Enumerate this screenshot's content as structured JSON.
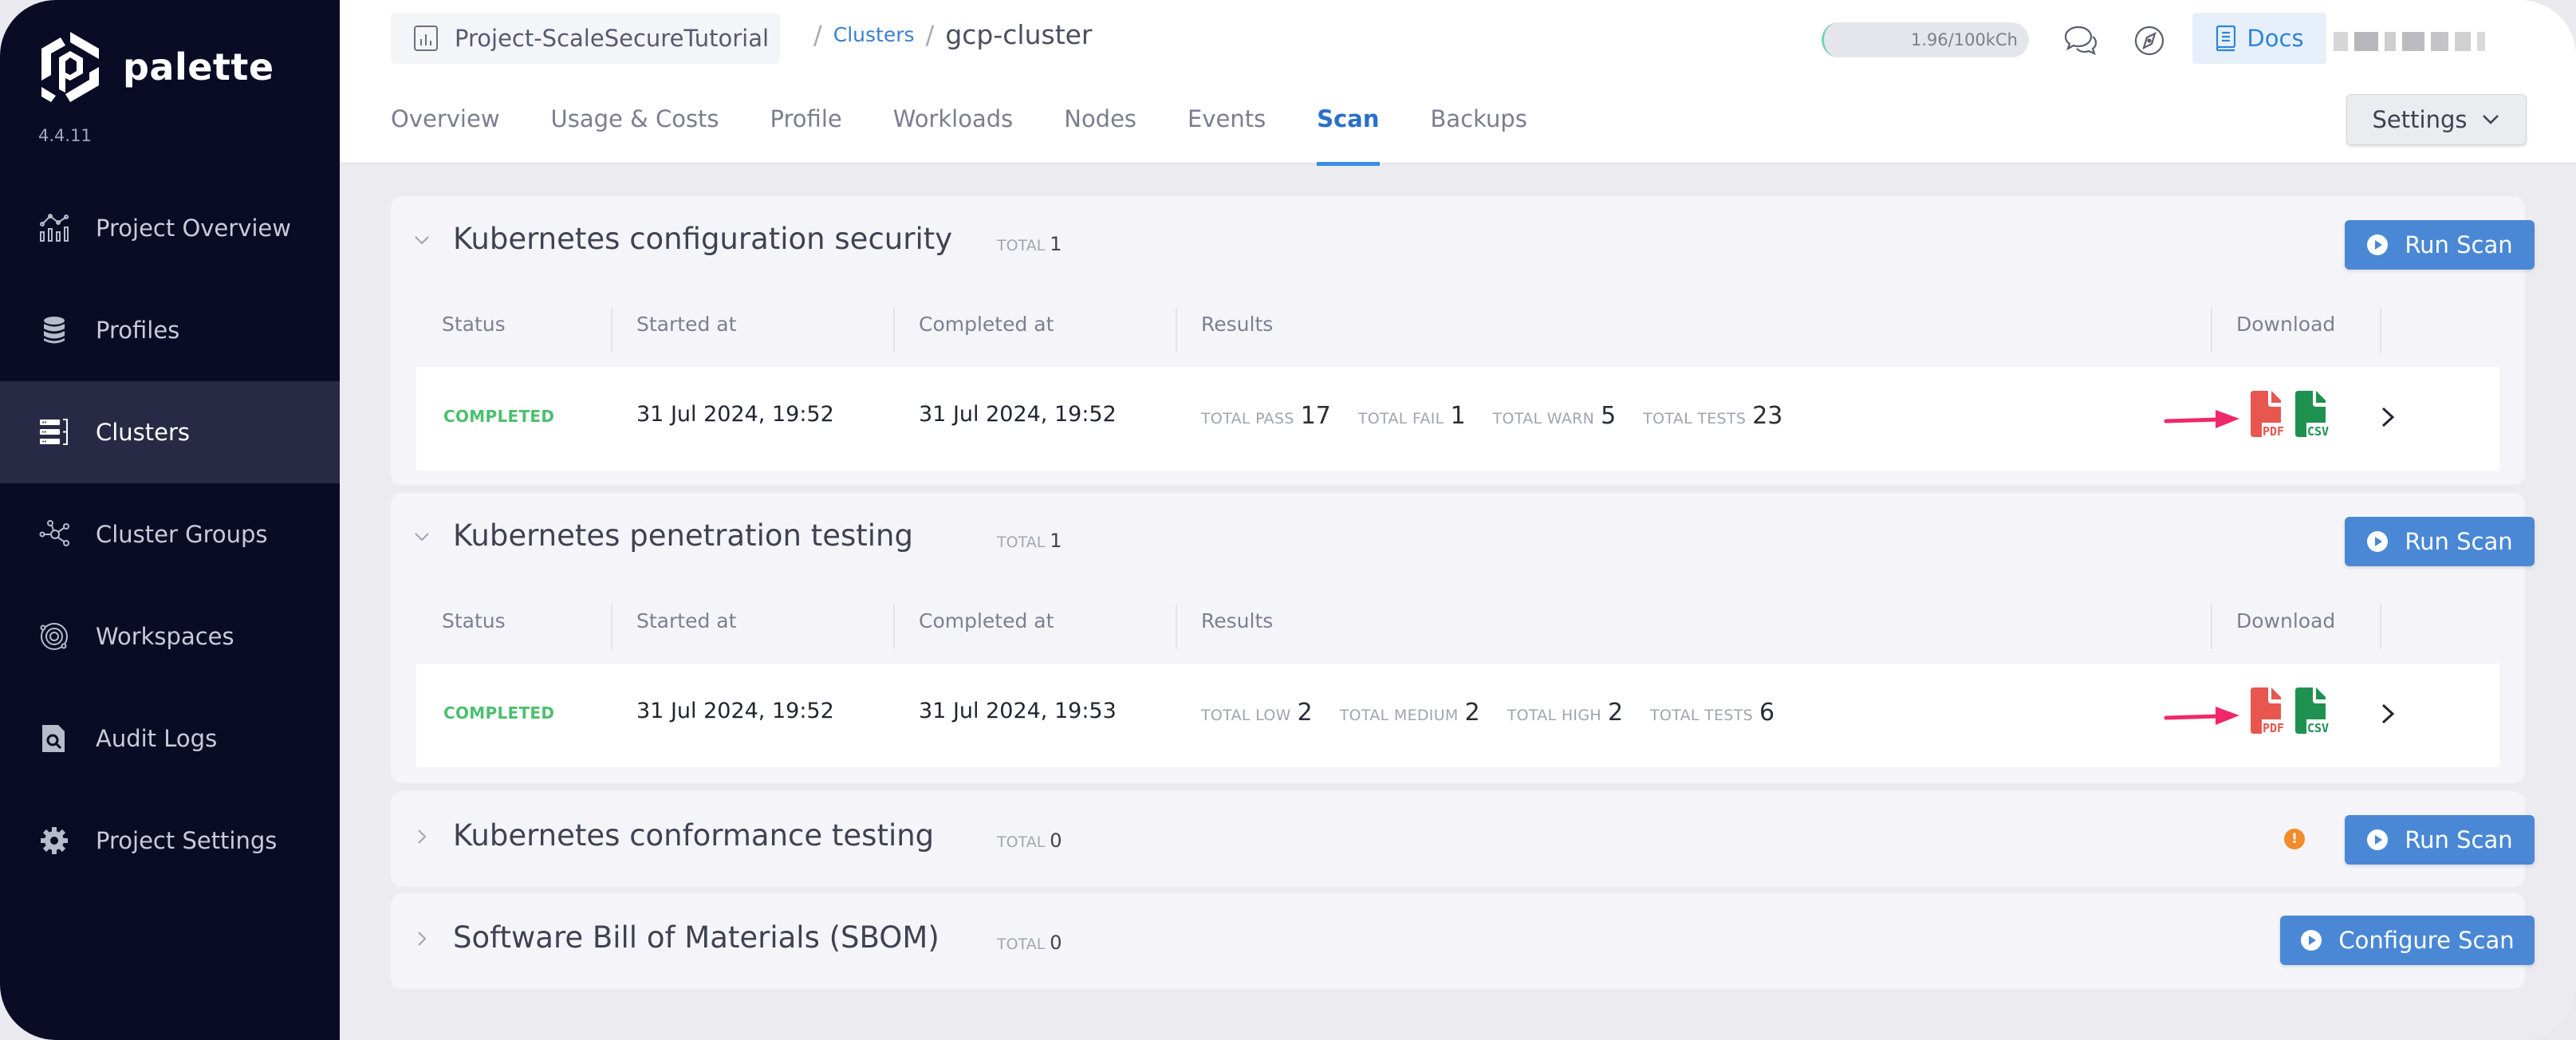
{
  "app": {
    "brand": "palette",
    "version": "4.4.11"
  },
  "sidebar": {
    "items": [
      {
        "label": "Project Overview",
        "icon": "chart-line-icon",
        "active": false
      },
      {
        "label": "Profiles",
        "icon": "database-stack-icon",
        "active": false
      },
      {
        "label": "Clusters",
        "icon": "server-rack-icon",
        "active": true
      },
      {
        "label": "Cluster Groups",
        "icon": "network-nodes-icon",
        "active": false
      },
      {
        "label": "Workspaces",
        "icon": "orbit-icon",
        "active": false
      },
      {
        "label": "Audit Logs",
        "icon": "document-search-icon",
        "active": false
      },
      {
        "label": "Project Settings",
        "icon": "gear-icon",
        "active": false
      }
    ]
  },
  "header": {
    "project": "Project-ScaleSecureTutorial",
    "breadcrumb": {
      "link": "Clusters",
      "current": "gcp-cluster"
    },
    "usage": "1.96/100kCh",
    "docs_label": "Docs",
    "settings_label": "Settings"
  },
  "tabs": [
    {
      "label": "Overview",
      "active": false
    },
    {
      "label": "Usage & Costs",
      "active": false
    },
    {
      "label": "Profile",
      "active": false
    },
    {
      "label": "Workloads",
      "active": false
    },
    {
      "label": "Nodes",
      "active": false
    },
    {
      "label": "Events",
      "active": false
    },
    {
      "label": "Scan",
      "active": true
    },
    {
      "label": "Backups",
      "active": false
    }
  ],
  "table_headers": {
    "status": "Status",
    "started": "Started at",
    "completed": "Completed at",
    "results": "Results",
    "download": "Download"
  },
  "scans": [
    {
      "title": "Kubernetes configuration security",
      "total_label": "TOTAL",
      "total": "1",
      "expanded": true,
      "button": "Run Scan",
      "row": {
        "status": "COMPLETED",
        "started": "31 Jul 2024, 19:52",
        "completed": "31 Jul 2024, 19:52",
        "results": [
          {
            "label": "TOTAL PASS",
            "value": "17"
          },
          {
            "label": "TOTAL FAIL",
            "value": "1"
          },
          {
            "label": "TOTAL WARN",
            "value": "5"
          },
          {
            "label": "TOTAL TESTS",
            "value": "23"
          }
        ],
        "downloads": [
          "PDF",
          "CSV"
        ]
      }
    },
    {
      "title": "Kubernetes penetration testing",
      "total_label": "TOTAL",
      "total": "1",
      "expanded": true,
      "button": "Run Scan",
      "row": {
        "status": "COMPLETED",
        "started": "31 Jul 2024, 19:52",
        "completed": "31 Jul 2024, 19:53",
        "results": [
          {
            "label": "TOTAL LOW",
            "value": "2"
          },
          {
            "label": "TOTAL MEDIUM",
            "value": "2"
          },
          {
            "label": "TOTAL HIGH",
            "value": "2"
          },
          {
            "label": "TOTAL TESTS",
            "value": "6"
          }
        ],
        "downloads": [
          "PDF",
          "CSV"
        ]
      }
    },
    {
      "title": "Kubernetes conformance testing",
      "total_label": "TOTAL",
      "total": "0",
      "expanded": false,
      "warning": "!",
      "button": "Run Scan"
    },
    {
      "title": "Software Bill of Materials (SBOM)",
      "total_label": "TOTAL",
      "total": "0",
      "expanded": false,
      "button": "Configure Scan"
    }
  ],
  "colors": {
    "sidebar_bg": "#0a0c26",
    "accent": "#4a88d6",
    "status_completed": "#4cc06e",
    "pdf": "#e8574f",
    "csv": "#1f9150",
    "annotation_arrow": "#f0286a",
    "warning": "#f08c2a"
  }
}
